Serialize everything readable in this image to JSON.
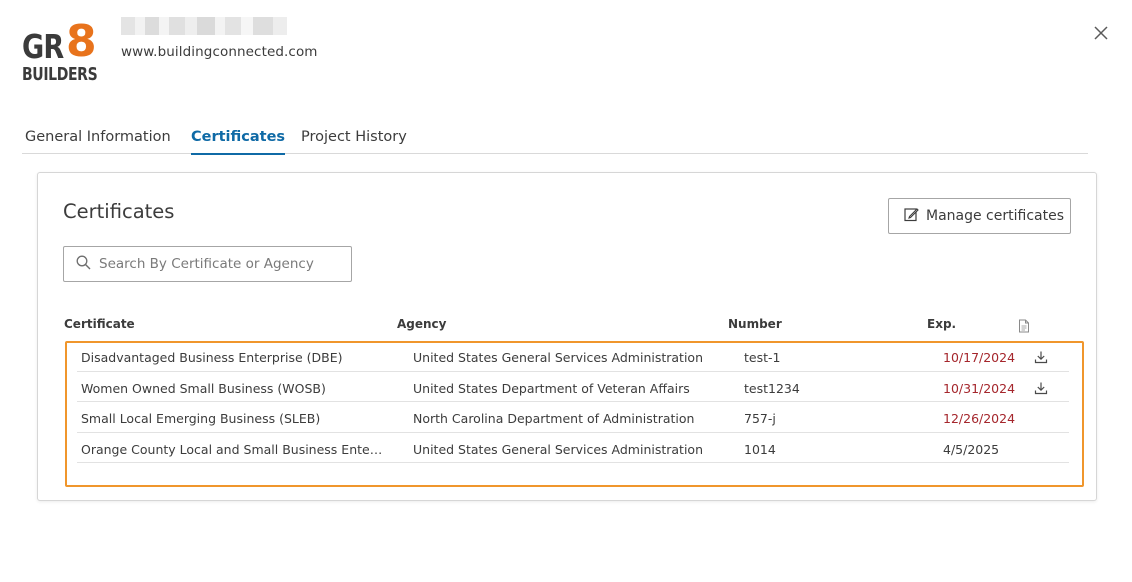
{
  "header": {
    "logo": {
      "text_main": "GR",
      "text_accent": "8",
      "text_sub": "BUILDERS"
    },
    "website": "www.buildingconnected.com"
  },
  "tabs": [
    {
      "label": "General Information",
      "active": false
    },
    {
      "label": "Certificates",
      "active": true
    },
    {
      "label": "Project History",
      "active": false
    }
  ],
  "certificates": {
    "title": "Certificates",
    "manage_label": "Manage certificates",
    "search_placeholder": "Search By Certificate or Agency",
    "columns": {
      "certificate": "Certificate",
      "agency": "Agency",
      "number": "Number",
      "exp": "Exp."
    },
    "rows": [
      {
        "certificate": "Disadvantaged Business Enterprise (DBE)",
        "agency": "United States General Services Administration",
        "number": "test-1",
        "exp": "10/17/2024",
        "expired": true,
        "has_file": true
      },
      {
        "certificate": "Women Owned Small Business (WOSB)",
        "agency": "United States Department of Veteran Affairs",
        "number": "test1234",
        "exp": "10/31/2024",
        "expired": true,
        "has_file": true
      },
      {
        "certificate": "Small Local Emerging Business (SLEB)",
        "agency": "North Carolina Department of Administration",
        "number": "757-j",
        "exp": "12/26/2024",
        "expired": true,
        "has_file": false
      },
      {
        "certificate": "Orange County Local and Small Business Enterprise ...",
        "agency": "United States General Services Administration",
        "number": "1014",
        "exp": "4/5/2025",
        "expired": false,
        "has_file": false
      }
    ]
  },
  "colors": {
    "accent_blue": "#0f6aa6",
    "logo_orange": "#e8731c",
    "expired_red": "#a5262c",
    "highlight_orange": "#f0962c"
  },
  "icons": {
    "close": "close-icon",
    "edit": "pencil-edit-icon",
    "search": "search-icon",
    "file_header": "document-icon",
    "download": "download-icon"
  }
}
